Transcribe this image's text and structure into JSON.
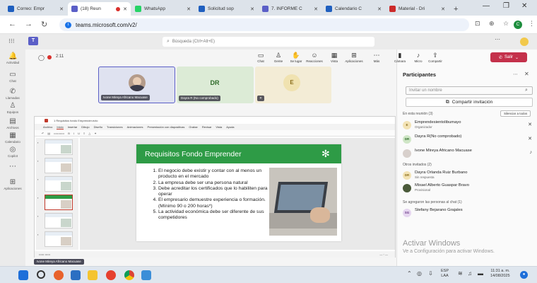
{
  "browser": {
    "tabs": [
      {
        "title": "Correo: Empr",
        "active": false,
        "color": "#1f5fbf"
      },
      {
        "title": "(18) Reun",
        "active": true,
        "color": "#5b5fc7"
      },
      {
        "title": "WhatsApp",
        "active": false,
        "color": "#25d366"
      },
      {
        "title": "Solicitud sop",
        "active": false,
        "color": "#1f5fbf"
      },
      {
        "title": "7. INFORME C",
        "active": false,
        "color": "#5b5fc7"
      },
      {
        "title": "Calendario C",
        "active": false,
        "color": "#1f5fbf"
      },
      {
        "title": "Material - Dri",
        "active": false,
        "color": "#cc2a2a"
      }
    ],
    "url": "teams.microsoft.com/v2/"
  },
  "teams": {
    "search_placeholder": "Búsqueda (Ctrl+Alt+E)",
    "meeting_timer": "2:11",
    "toolbar": [
      {
        "label": "Chat",
        "icon": "chat-icon",
        "glyph": "▭"
      },
      {
        "label": "Gente",
        "icon": "people-icon",
        "glyph": "♙"
      },
      {
        "label": "Se lugar",
        "icon": "raise-hand-icon",
        "glyph": "✋"
      },
      {
        "label": "Reacciones",
        "icon": "smile-icon",
        "glyph": "☺"
      },
      {
        "label": "Vista",
        "icon": "view-icon",
        "glyph": "▦"
      },
      {
        "label": "Aplicaciones",
        "icon": "apps-icon",
        "glyph": "⊞"
      },
      {
        "label": "Más",
        "icon": "more-icon",
        "glyph": "⋯"
      },
      {
        "label": "Cámara",
        "icon": "camera-icon",
        "glyph": "▮"
      },
      {
        "label": "Micro",
        "icon": "mic-icon",
        "glyph": "♪"
      },
      {
        "label": "Compartir",
        "icon": "share-icon",
        "glyph": "⇪"
      }
    ],
    "leave_label": "Salir",
    "rail": [
      {
        "label": "Actividad",
        "glyph": "🔔"
      },
      {
        "label": "Chat",
        "glyph": "▭"
      },
      {
        "label": "Llamadas",
        "glyph": "✆"
      },
      {
        "label": "Equipos",
        "glyph": "♙"
      },
      {
        "label": "Archivos",
        "glyph": "▤"
      },
      {
        "label": "Calendario",
        "glyph": "▦"
      },
      {
        "label": "Copilot",
        "glyph": "◎"
      },
      {
        "label": "",
        "glyph": "⋯"
      },
      {
        "label": "Aplicaciones",
        "glyph": "⊞"
      }
    ],
    "tiles": [
      {
        "name": "Ivone Mireya Africano Macuase",
        "initials": "",
        "bg": "#dfe2f0"
      },
      {
        "name": "Dayra R (No comprobado)",
        "initials": "DR",
        "bg": "#dcebd6"
      },
      {
        "name": "",
        "initials": "E",
        "bg": "#f3ecd6"
      }
    ]
  },
  "ppt": {
    "filename": "1 Requisitos fondo Emprender.ecto",
    "menu": [
      "Archivo",
      "Inicio",
      "Insertar",
      "Dibujo",
      "Diseño",
      "Transiciones",
      "Animaciones",
      "Presentación con diapositivas",
      "Grabar",
      "Revisar",
      "Vista",
      "Ayuda"
    ],
    "slide_title": "Requisitos Fondo Emprender",
    "slide_items": [
      "El negocio debe existir y contar con al menos un producto en el mercado",
      "La empresa debe ser una persona natural",
      "Debe acreditar los certificados que lo habiliten para operar",
      "El empresario demuestre experiencia o formación.  (Mínimo 90 o 200 horas*)",
      "La actividad económica debe ser diferente de sus competidores"
    ],
    "presenter_chip": "Ivone Mireya Africano Macuase"
  },
  "panel": {
    "title": "Participantes",
    "search_placeholder": "Invitar un nombre",
    "invite_label": "Compartir invitación",
    "in_meeting": "En esta reunión (3)",
    "mute_all": "Silenciar a todos",
    "people": [
      {
        "name": "Emprendesientolibumayo",
        "role": "Organizador",
        "initials": "E",
        "bg": "#f3e3b5",
        "fg": "#8a6d1a",
        "icon": "mic-off-icon",
        "glyph": "✕"
      },
      {
        "name": "Dayra R(No comprobado)",
        "role": "",
        "initials": "DR",
        "bg": "#cfe6c6",
        "fg": "#2f6b2a",
        "icon": "mic-off-icon",
        "glyph": "✕"
      },
      {
        "name": "Ivone Mireya Africano Macuase",
        "role": "",
        "initials": "",
        "bg": "#d8d0cc",
        "fg": "#444",
        "icon": "mic-icon",
        "glyph": "♪"
      }
    ],
    "others_invited": "Otros invitados (2)",
    "others": [
      {
        "name": "Dayra Orlanda Ruiz Burbano",
        "role": "Sin respuesta",
        "initials": "DR",
        "bg": "#f3e3b5",
        "fg": "#8a6d1a"
      },
      {
        "name": "Mixael Alberto Guaspar Bravo",
        "role": "Provisional",
        "initials": "",
        "bg": "#4a5a3a",
        "fg": "#fff"
      }
    ],
    "added_section": "Se agregaron las personas al chat (1)",
    "added": [
      {
        "name": "Stefany Bejarano Grajales",
        "role": "",
        "initials": "SG",
        "bg": "#e6d6f0",
        "fg": "#6a3b86"
      }
    ]
  },
  "watermark": {
    "line1": "Activar Windows",
    "line2": "Ve a Configuración para activar Windows."
  },
  "taskbar": {
    "lang": "ESP",
    "lang2": "LAA",
    "time": "11:31 a. m.",
    "date": "14/08/2025"
  }
}
